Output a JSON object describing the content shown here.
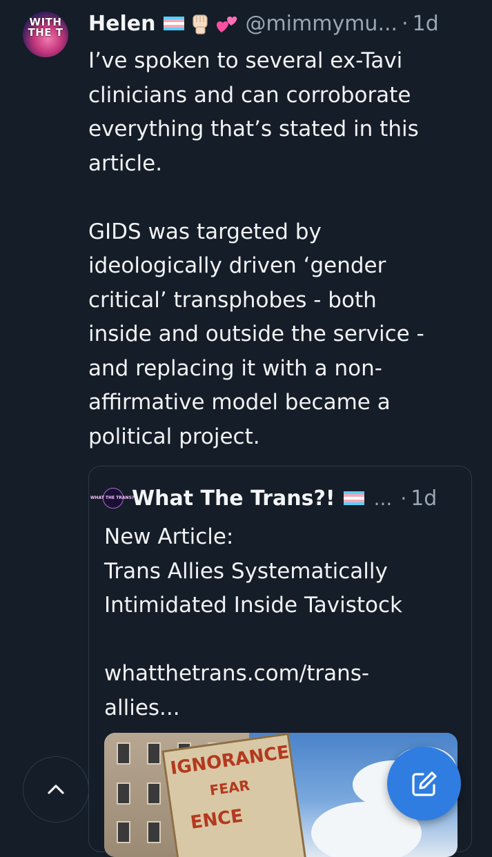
{
  "post": {
    "author": {
      "avatar_text": "WITH THE T",
      "name": "Helen",
      "handle": "@mimmymu...",
      "separator": "·",
      "time": "1d",
      "name_emoji_icons": [
        "trans-flag-icon",
        "raised-fist-icon",
        "two-hearts-icon"
      ]
    },
    "body": {
      "line1": "I’ve spoken to several ex-Tavi",
      "line2": "clinicians and can corroborate",
      "line3": "everything that’s stated in this",
      "line4": "article.",
      "line5": "GIDS was targeted by",
      "line6": "ideologically driven ‘gender",
      "line7": "critical’ transphobes - both",
      "line8": "inside and outside the service -",
      "line9": "and replacing it with a non-",
      "line10": "affirmative model became a",
      "line11": "political project."
    }
  },
  "quote": {
    "avatar_text": "WHAT THE TRANS?!",
    "name": "What The Trans?!",
    "ellipsis": "...",
    "separator": "·",
    "time": "1d",
    "text": {
      "line1": "New Article:",
      "line2": "Trans Allies Systematically",
      "line3": "Intimidated Inside Tavistock",
      "line4": "whatthetrans.com/trans-",
      "line5": "allies..."
    },
    "image": {
      "sign_line1": "IGNORANCE",
      "sign_line2": "FEAR",
      "sign_line3": "ENCE"
    }
  },
  "controls": {
    "scroll_up_icon": "chevron-up-icon",
    "compose_icon": "compose-icon"
  },
  "colors": {
    "background": "#151d28",
    "text": "#f1f3f5",
    "muted": "#9aa6b4",
    "accent": "#2f7de0",
    "border": "#2e3a48"
  }
}
